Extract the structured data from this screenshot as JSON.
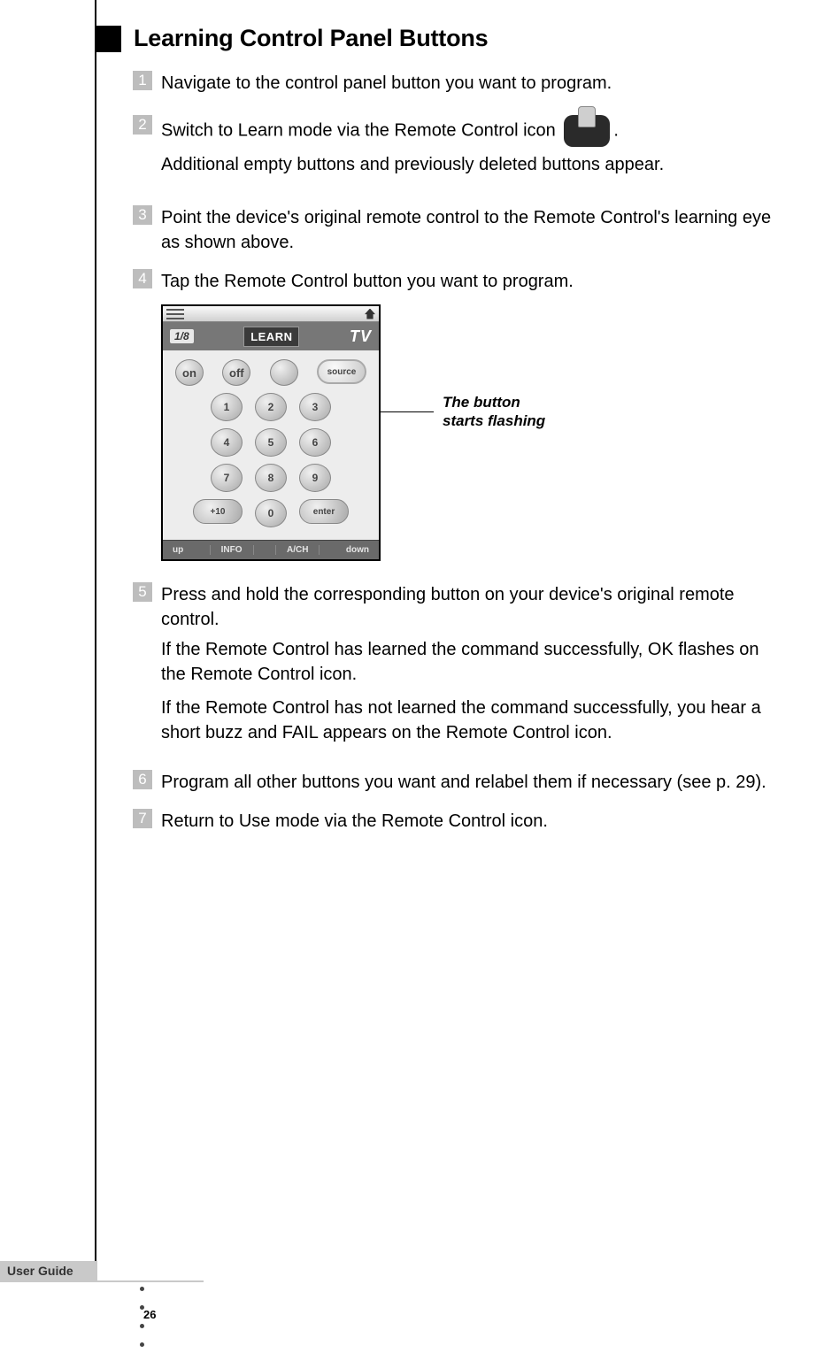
{
  "heading": "Learning Control Panel Buttons",
  "steps": [
    {
      "num": "1",
      "text": "Navigate to the control panel button you want to program."
    },
    {
      "num": "2",
      "text_pre": "Switch to Learn mode via the Remote Control icon ",
      "text_post": ".",
      "line2": "Additional empty buttons and previously deleted buttons appear."
    },
    {
      "num": "3",
      "text": "Point the device's original remote control to the Remote Control's learning eye as shown above."
    },
    {
      "num": "4",
      "text": "Tap the Remote Control button you want to program."
    },
    {
      "num": "5",
      "text": "Press and hold the corresponding button on your device's original remote control.",
      "para2": "If the Remote Control has learned the command successfully, OK flashes on the Remote Control icon.",
      "para3": "If the Remote Control has not learned the command successfully, you hear a short buzz and FAIL appears on the Remote Control icon."
    },
    {
      "num": "6",
      "text": "Program all other buttons you want and relabel them if necessary (see p. 29)."
    },
    {
      "num": "7",
      "text": "Return to Use mode via the Remote Control icon."
    }
  ],
  "figure": {
    "page_indicator": "1/8",
    "learn_label": "LEARN",
    "device": "TV",
    "buttons": {
      "on": "on",
      "off": "off",
      "source": "source",
      "k1": "1",
      "k2": "2",
      "k3": "3",
      "k4": "4",
      "k5": "5",
      "k6": "6",
      "k7": "7",
      "k8": "8",
      "k9": "9",
      "plus10": "+10",
      "k0": "0",
      "enter": "enter"
    },
    "footer": {
      "up": "up",
      "info": "INFO",
      "avch": "A/CH",
      "down": "down"
    },
    "callout": "The button starts flashing"
  },
  "footer": {
    "guide": "User Guide",
    "page": "26"
  }
}
